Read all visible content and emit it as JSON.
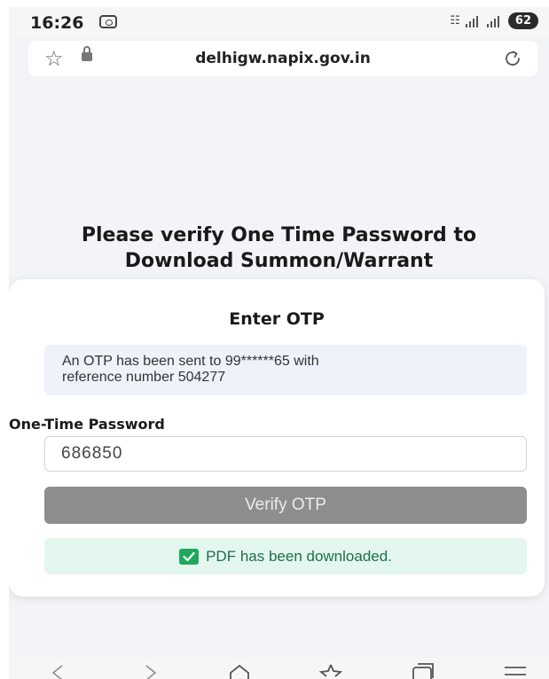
{
  "status_bar": {
    "time": "16:26",
    "battery": "62"
  },
  "browser": {
    "url": "delhigw.napix.gov.in"
  },
  "page": {
    "title_line1": "Please verify One Time Password to",
    "title_line2": "Download Summon/Warrant"
  },
  "card": {
    "title": "Enter OTP",
    "info_line1": "An OTP has been sent to 99******65 with",
    "info_line2": "reference number 504277",
    "field_label": "One-Time Password",
    "otp_value": "686850",
    "verify_label": "Verify OTP",
    "success_message": "PDF has been downloaded."
  },
  "icons": {
    "bookmark": "star-icon",
    "secure": "lock-icon",
    "reload": "reload-icon",
    "nav_back": "chevron-left-icon",
    "nav_forward": "chevron-right-icon",
    "nav_home": "home-icon",
    "nav_bookmarks": "star-icon",
    "nav_tabs": "tabs-icon",
    "nav_menu": "menu-icon"
  },
  "colors": {
    "page_bg": "#f3f4f8",
    "button_disabled": "#8e8e8e",
    "success_bg": "#e3f7ee",
    "success_text": "#1e6e4b",
    "check_green": "#1fa85c",
    "info_bg": "#eef2fa"
  }
}
